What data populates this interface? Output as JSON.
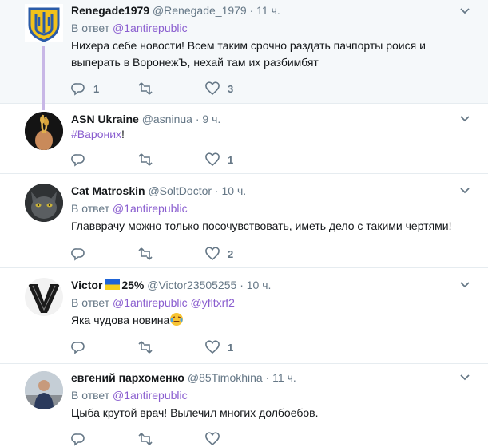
{
  "reply_prefix": "В ответ",
  "tweets": [
    {
      "name": "Renegade1979",
      "handle": "@Renegade_1979",
      "time": "11 ч.",
      "mentions": [
        "@1antirepublic"
      ],
      "text": "Нихера себе новости! Всем таким срочно раздать пачпорты роися и выперать в ВоронежЪ, нехай там их разбимбят",
      "line1": "Нихера себе новости! Всем таким срочно раздать пачпорты роися и",
      "line2": "выперать в ВоронежЪ, нехай там их разбимбят",
      "replies": "1",
      "retweets": "",
      "likes": "3",
      "avatar": "coat-of-arms-icon"
    },
    {
      "name": "ASN Ukraine",
      "handle": "@asninua",
      "time": "9 ч.",
      "hashtag": "#Вароних",
      "suffix": "!",
      "replies": "",
      "retweets": "",
      "likes": "1",
      "avatar": "hand-with-wheat-avatar"
    },
    {
      "name": "Cat Matroskin",
      "handle": "@SoltDoctor",
      "time": "10 ч.",
      "mentions": [
        "@1antirepublic"
      ],
      "text": "Главврачу можно только посочувствовать, иметь дело с такими чертями!",
      "replies": "",
      "retweets": "",
      "likes": "2",
      "avatar": "cat-avatar"
    },
    {
      "name": "Victor",
      "name_suffix": "25%",
      "handle": "@Victor23505255",
      "time": "10 ч.",
      "mentions": [
        "@1antirepublic",
        "@yfltxrf2"
      ],
      "text": "Яка чудова новина",
      "replies": "",
      "retweets": "",
      "likes": "1",
      "avatar": "victor-logo-avatar"
    },
    {
      "name": "евгений пархоменко",
      "handle": "@85Timokhina",
      "time": "11 ч.",
      "mentions": [
        "@1antirepublic"
      ],
      "text": "Цыба крутой врач! Вылечил многих долбоебов.",
      "avatar": "person-avatar"
    }
  ],
  "colors": {
    "accent": "#8a5ecf",
    "thread_line": "#c8b7e6",
    "muted": "#657786",
    "divider": "#e6ecf0",
    "first_bg": "#f5f8fa"
  }
}
